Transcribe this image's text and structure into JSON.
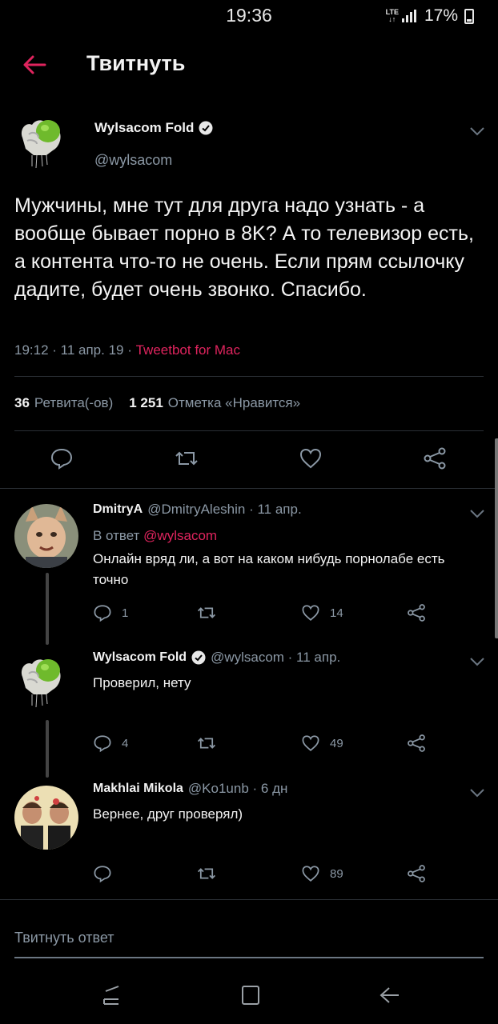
{
  "status_bar": {
    "time": "19:36",
    "network": "LTE",
    "battery": "17%"
  },
  "header": {
    "title": "Твитнуть"
  },
  "main_tweet": {
    "author_name": "Wylsacom Fold",
    "handle": "@wylsacom",
    "text": "Мужчины, мне тут для друга надо узнать - а вообще бывает порно в 8K? А то телевизор есть, а контента что-то не очень. Если прям ссылочку дадите, будет очень звонко. Спасибо.",
    "meta_time": "19:12 · 11 апр. 19 · ",
    "meta_source": "Tweetbot for Mac",
    "retweets_count": "36",
    "retweets_label": "Ретвита(-ов)",
    "likes_count": "1 251",
    "likes_label": "Отметка «Нравится»"
  },
  "replies": [
    {
      "author_name": "DmitryA",
      "handle_date": "@DmitryAleshin · 11 апр.",
      "reply_to_prefix": "В ответ ",
      "reply_to_handle": "@wylsacom",
      "text": "Онлайн вряд ли, а вот на каком нибудь порнолабе есть точно",
      "reply_count": "1",
      "retweet_count": "",
      "like_count": "14"
    },
    {
      "author_name": "Wylsacom Fold",
      "handle_date": "@wylsacom · 11 апр.",
      "text": "Проверил, нету",
      "reply_count": "4",
      "retweet_count": "",
      "like_count": "49"
    },
    {
      "author_name": "Makhlai Mikola",
      "handle_date": "@Ko1unb · 6 дн",
      "text": "Вернее,  друг проверял)",
      "reply_count": "",
      "retweet_count": "",
      "like_count": "89"
    }
  ],
  "reply_box": {
    "placeholder": "Твитнуть ответ"
  },
  "colors": {
    "accent": "#e0245e",
    "secondary_text": "#8b98a5",
    "background": "#000000"
  }
}
